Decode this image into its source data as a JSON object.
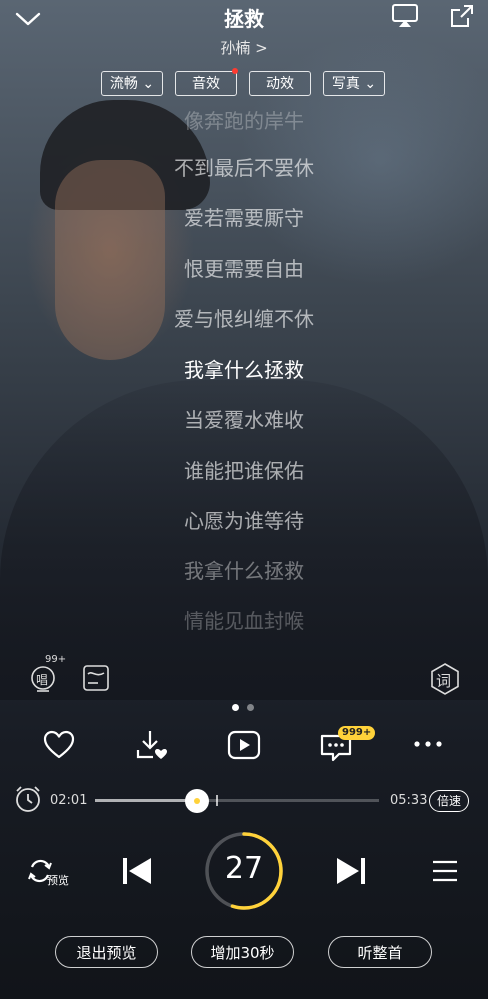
{
  "header": {
    "title": "拯救",
    "artist": "孙楠 >",
    "chips": [
      "流畅 ⌄",
      "音效",
      "动效",
      "写真 ⌄"
    ]
  },
  "lyrics": [
    "像奔跑的岸牛",
    "不到最后不罢休",
    "爱若需要厮守",
    "恨更需要自由",
    "爱与恨纠缠不休",
    "我拿什么拯救",
    "当爱覆水难收",
    "谁能把谁保佑",
    "心愿为谁等待",
    "我拿什么拯救",
    "情能见血封喉"
  ],
  "tools": {
    "sing_badge": "99+",
    "sing_label": "唱",
    "lyric_label": "词"
  },
  "actions": {
    "comment_badge": "999+"
  },
  "progress": {
    "current": "02:01",
    "total": "05:33",
    "fraction": 0.36,
    "speed_label": "倍速"
  },
  "controls": {
    "preview_label": "预览",
    "countdown": "27",
    "countdown_fraction": 0.55
  },
  "buttons": {
    "exit_preview": "退出预览",
    "add_30s": "增加30秒",
    "full_song": "听整首"
  },
  "colors": {
    "accent": "#ffd23a",
    "red_dot": "#ff3b30"
  }
}
